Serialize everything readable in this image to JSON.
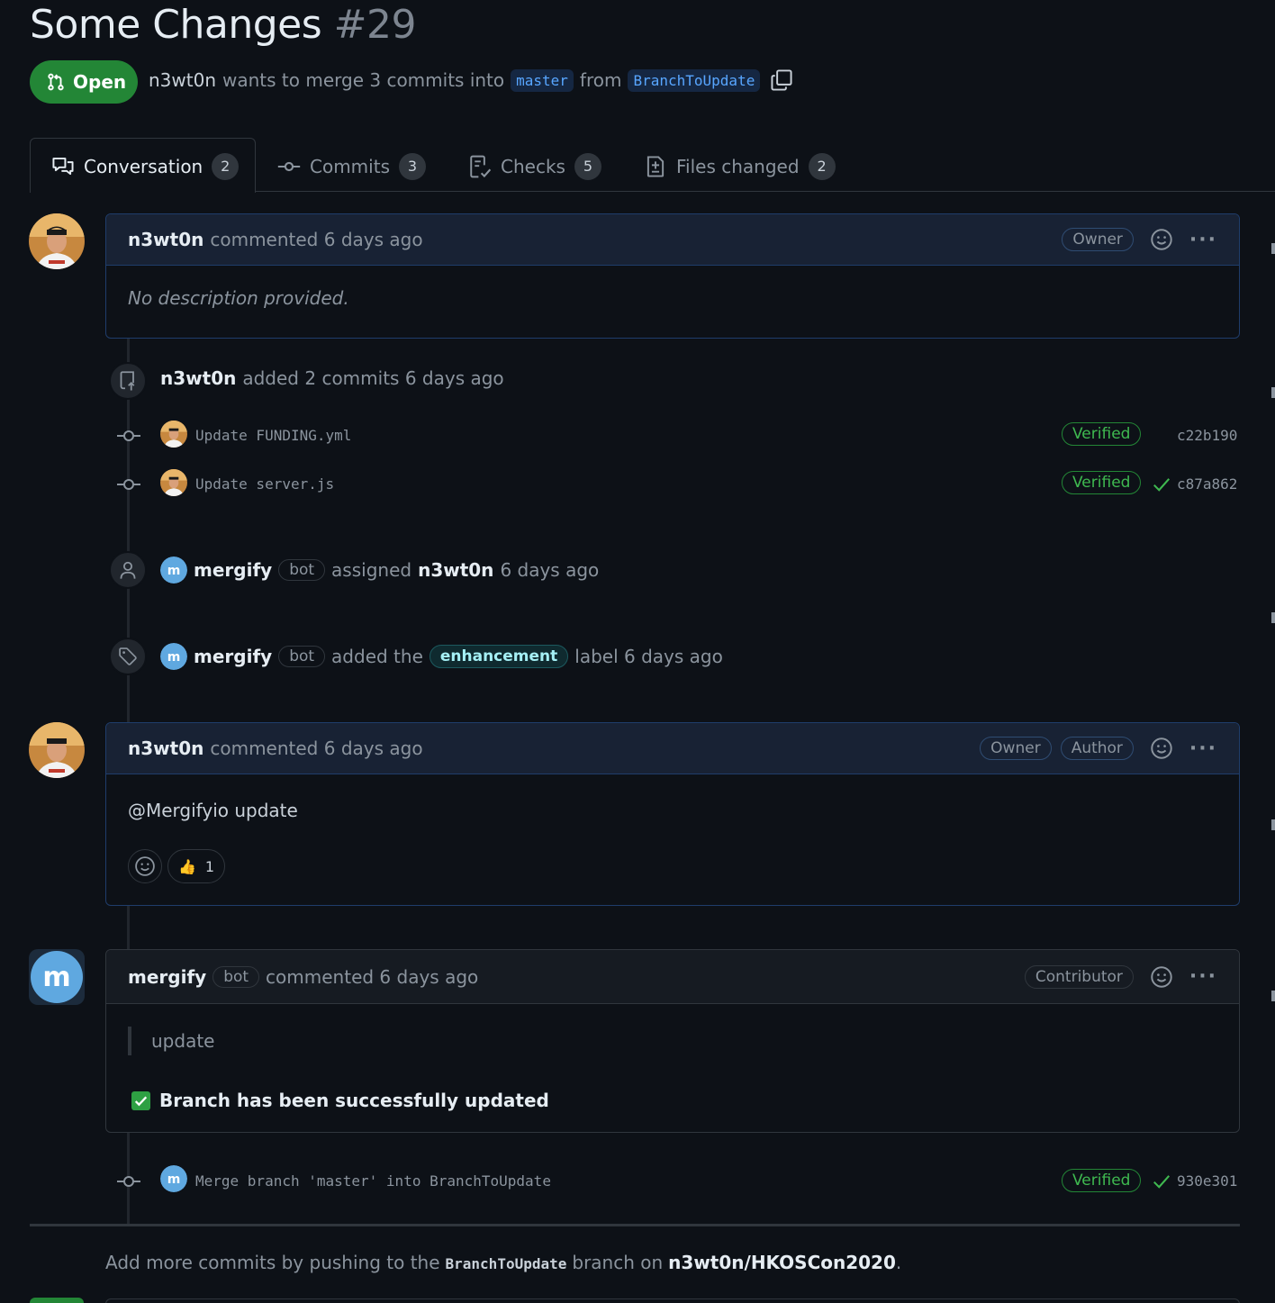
{
  "pr": {
    "title": "Some Changes",
    "number": "#29",
    "state": "Open",
    "author": "n3wt0n",
    "merge_text": "wants to merge 3 commits into",
    "base_branch": "master",
    "from_text": "from",
    "head_branch": "BranchToUpdate"
  },
  "tabs": [
    {
      "label": "Conversation",
      "count": "2",
      "icon": "comment-discussion-icon"
    },
    {
      "label": "Commits",
      "count": "3",
      "icon": "git-commit-icon"
    },
    {
      "label": "Checks",
      "count": "5",
      "icon": "checklist-icon"
    },
    {
      "label": "Files changed",
      "count": "2",
      "icon": "file-diff-icon"
    }
  ],
  "comment1": {
    "author": "n3wt0n",
    "action": "commented 6 days ago",
    "role": "Owner",
    "body": "No description provided."
  },
  "commits_event": {
    "author": "n3wt0n",
    "text": "added 2 commits 6 days ago",
    "commits": [
      {
        "message": "Update FUNDING.yml",
        "verified": "Verified",
        "sha": "c22b190",
        "check": false
      },
      {
        "message": "Update server.js",
        "verified": "Verified",
        "sha": "c87a862",
        "check": true
      }
    ]
  },
  "assign_event": {
    "actor": "mergify",
    "bot": "bot",
    "text": "assigned",
    "assignee": "n3wt0n",
    "time": "6 days ago"
  },
  "label_event": {
    "actor": "mergify",
    "bot": "bot",
    "text": "added the",
    "label": "enhancement",
    "label_color": "#a5f0f5",
    "suffix": "label 6 days ago"
  },
  "comment2": {
    "author": "n3wt0n",
    "action": "commented 6 days ago",
    "roles": [
      "Owner",
      "Author"
    ],
    "body": "@Mergifyio update",
    "reaction_count": "1"
  },
  "comment3": {
    "author": "mergify",
    "bot": "bot",
    "action": "commented 6 days ago",
    "role": "Contributor",
    "quote": "update",
    "status": "Branch has been successfully updated"
  },
  "merge_commit": {
    "message": "Merge branch 'master' into BranchToUpdate",
    "verified": "Verified",
    "sha": "930e301"
  },
  "footer": {
    "prefix": "Add more commits by pushing to the",
    "branch": "BranchToUpdate",
    "middle": "branch on",
    "repo": "n3wt0n/HKOSCon2020",
    "end": "."
  },
  "colors": {
    "open_green": "#238636",
    "link_blue": "#58a6ff",
    "verified_green": "#3fb950"
  }
}
